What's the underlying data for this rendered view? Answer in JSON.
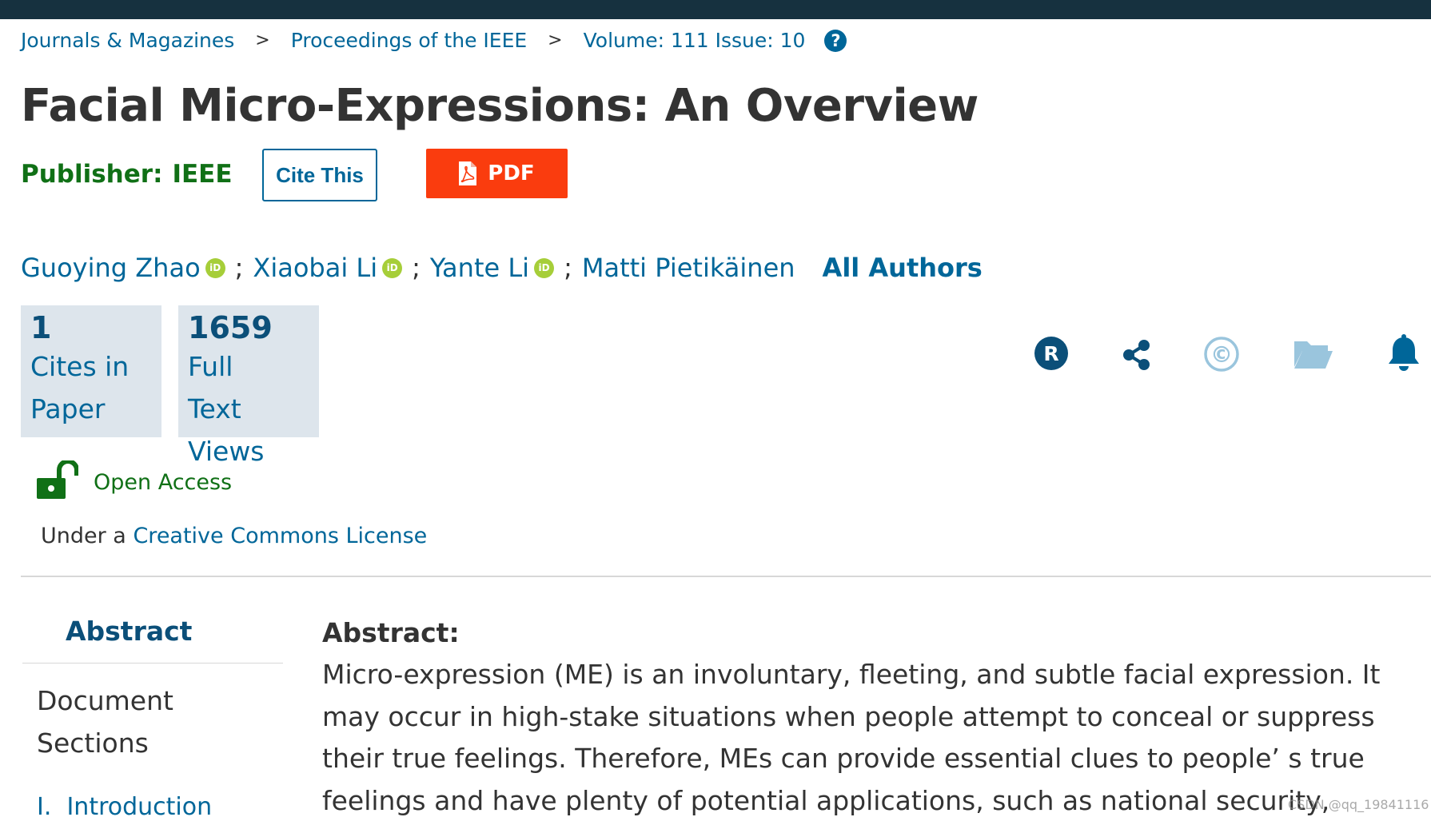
{
  "breadcrumb": {
    "items": [
      "Journals & Magazines",
      "Proceedings of the IEEE",
      "Volume: 111 Issue: 10"
    ],
    "separator": ">",
    "help_icon": "question-circle-icon",
    "help_glyph": "?"
  },
  "article": {
    "title": "Facial Micro-Expressions: An Overview",
    "publisher_label": "Publisher:",
    "publisher": "IEEE"
  },
  "actions": {
    "cite_label": "Cite This",
    "pdf_label": "PDF"
  },
  "authors": {
    "list": [
      "Guoying Zhao",
      "Xiaobai Li",
      "Yante Li",
      "Matti Pietikäinen"
    ],
    "orcid_badge": "iD",
    "separator": ";",
    "all_authors_label": "All Authors"
  },
  "metrics": {
    "cites": {
      "value": "1",
      "label": "Cites in Paper"
    },
    "views": {
      "value": "1659",
      "label": "Full Text Views"
    }
  },
  "tools": {
    "icons": [
      "rights-r-icon",
      "share-icon",
      "copyright-icon",
      "folder-open-icon",
      "bell-icon"
    ],
    "rights_glyph": "R",
    "copyright_glyph": "©"
  },
  "access": {
    "open_access_label": "Open Access",
    "license_prefix": "Under a",
    "license_link": "Creative Commons License"
  },
  "sidebar": {
    "abstract_label": "Abstract",
    "document_sections_label": "Document Sections",
    "intro_label": "I.  Introduction"
  },
  "abstract": {
    "heading": "Abstract:",
    "body": "Micro-expression (ME) is an involuntary, fleeting, and subtle facial expression. It may occur in high-stake situations when people attempt to conceal or suppress their true feelings. Therefore, MEs can provide essential clues to people’ s true feelings and have plenty of potential applications, such as national security, clinical diagnosis, and interrogations. In"
  },
  "watermark": "CSDN @qq_19841116",
  "colors": {
    "topbar": "#16313f",
    "link": "#006699",
    "publisher_green": "#107016",
    "pdf_red": "#fa3c0e",
    "orcid_green": "#a6ce39",
    "metric_bg": "#dde5ec",
    "dark_blue": "#0b4f79"
  }
}
